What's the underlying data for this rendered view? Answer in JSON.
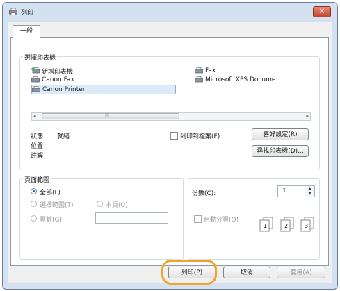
{
  "window": {
    "title": "列印",
    "close_glyph": "✕"
  },
  "tabs": [
    {
      "label": "一般"
    }
  ],
  "printer_group": {
    "label": "選擇印表機",
    "printers": [
      {
        "name": "新增印表機",
        "icon": "add-printer-icon"
      },
      {
        "name": "Fax",
        "icon": "printer-icon"
      },
      {
        "name": "Canon Fax",
        "icon": "printer-icon"
      },
      {
        "name": "Microsoft XPS Docume",
        "icon": "printer-icon"
      },
      {
        "name": "Canon Printer",
        "icon": "printer-icon",
        "selected": true
      }
    ],
    "scroll_left": "◂",
    "scroll_right": "▸",
    "scroll_grip": "|||",
    "status_label": "狀態:",
    "status_value": "就緒",
    "location_label": "位置:",
    "comment_label": "註解:",
    "print_to_file_label": "列印到檔案(F)",
    "preferences_button": "喜好設定(R)",
    "find_printer_button": "尋找印表機(D)..."
  },
  "page_range": {
    "label": "頁面範圍",
    "all_label": "全部(L)",
    "selection_label": "選擇範圍(T)",
    "current_page_label": "本頁(U)",
    "pages_label": "頁數(G):",
    "pages_value": ""
  },
  "copies": {
    "label": "份數(C):",
    "value": "1",
    "spin_up": "▲",
    "spin_down": "▼",
    "collate_label": "自動分頁(O)",
    "collate_pages": [
      "1",
      "2",
      "3"
    ]
  },
  "buttons": {
    "print": "列印(P)",
    "cancel": "取消",
    "apply": "套用(A)"
  },
  "colors": {
    "highlight": "#f0a52a",
    "title_bar": "#d3e1f1",
    "close": "#c3452d"
  }
}
